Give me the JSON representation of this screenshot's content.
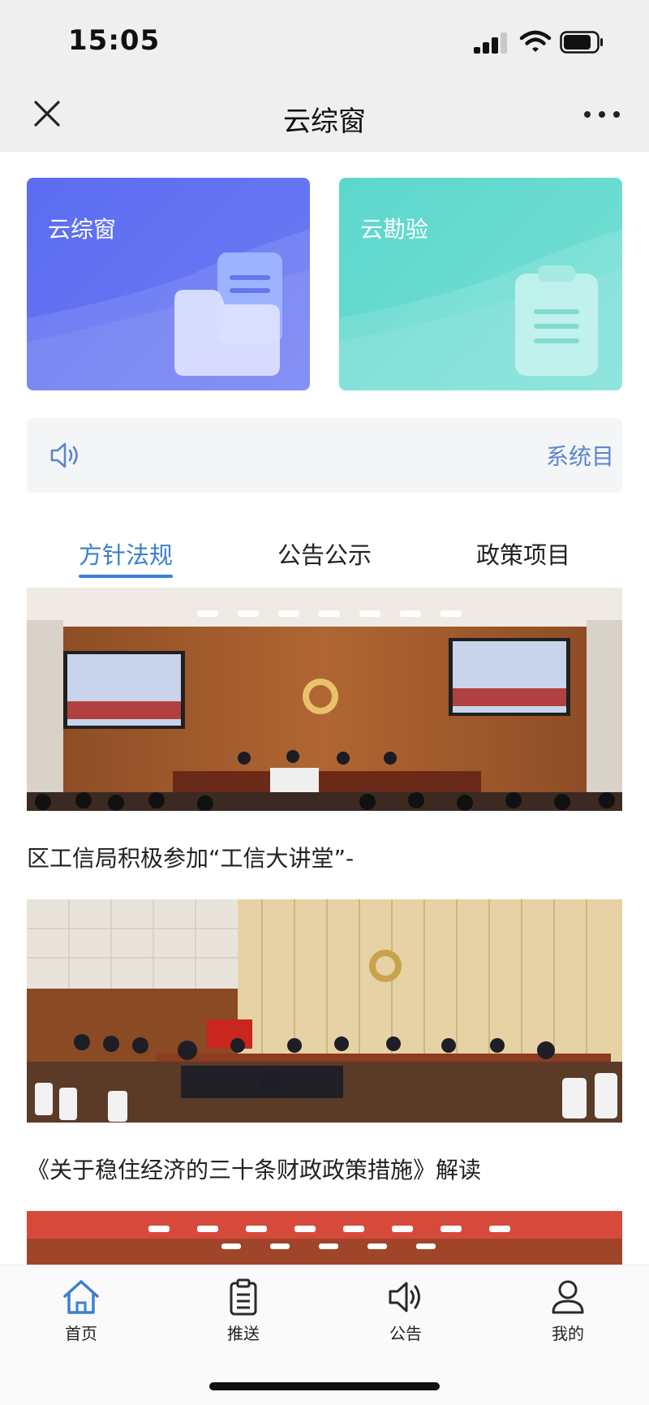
{
  "status_bar": {
    "time": "15:05"
  },
  "nav": {
    "title": "云综窗"
  },
  "cards": [
    {
      "label": "云综窗",
      "color": "#5b6cf0"
    },
    {
      "label": "云勘验",
      "color": "#5cd7cc"
    }
  ],
  "notice": {
    "text": "系统目"
  },
  "tabs": [
    {
      "label": "方针法规",
      "active": true
    },
    {
      "label": "公告公示",
      "active": false
    },
    {
      "label": "政策项目",
      "active": false
    }
  ],
  "news": [
    {
      "title": "区工信局积极参加“工信大讲堂”-"
    },
    {
      "title": "《关于稳住经济的三十条财政政策措施》解读"
    }
  ],
  "bottom_tabs": [
    {
      "label": "首页",
      "icon": "home-icon",
      "active": true
    },
    {
      "label": "推送",
      "icon": "clipboard-icon",
      "active": false
    },
    {
      "label": "公告",
      "icon": "speaker-icon",
      "active": false
    },
    {
      "label": "我的",
      "icon": "person-icon",
      "active": false
    }
  ],
  "colors": {
    "accent": "#3b7fd0",
    "notice_text": "#5a86c9"
  }
}
